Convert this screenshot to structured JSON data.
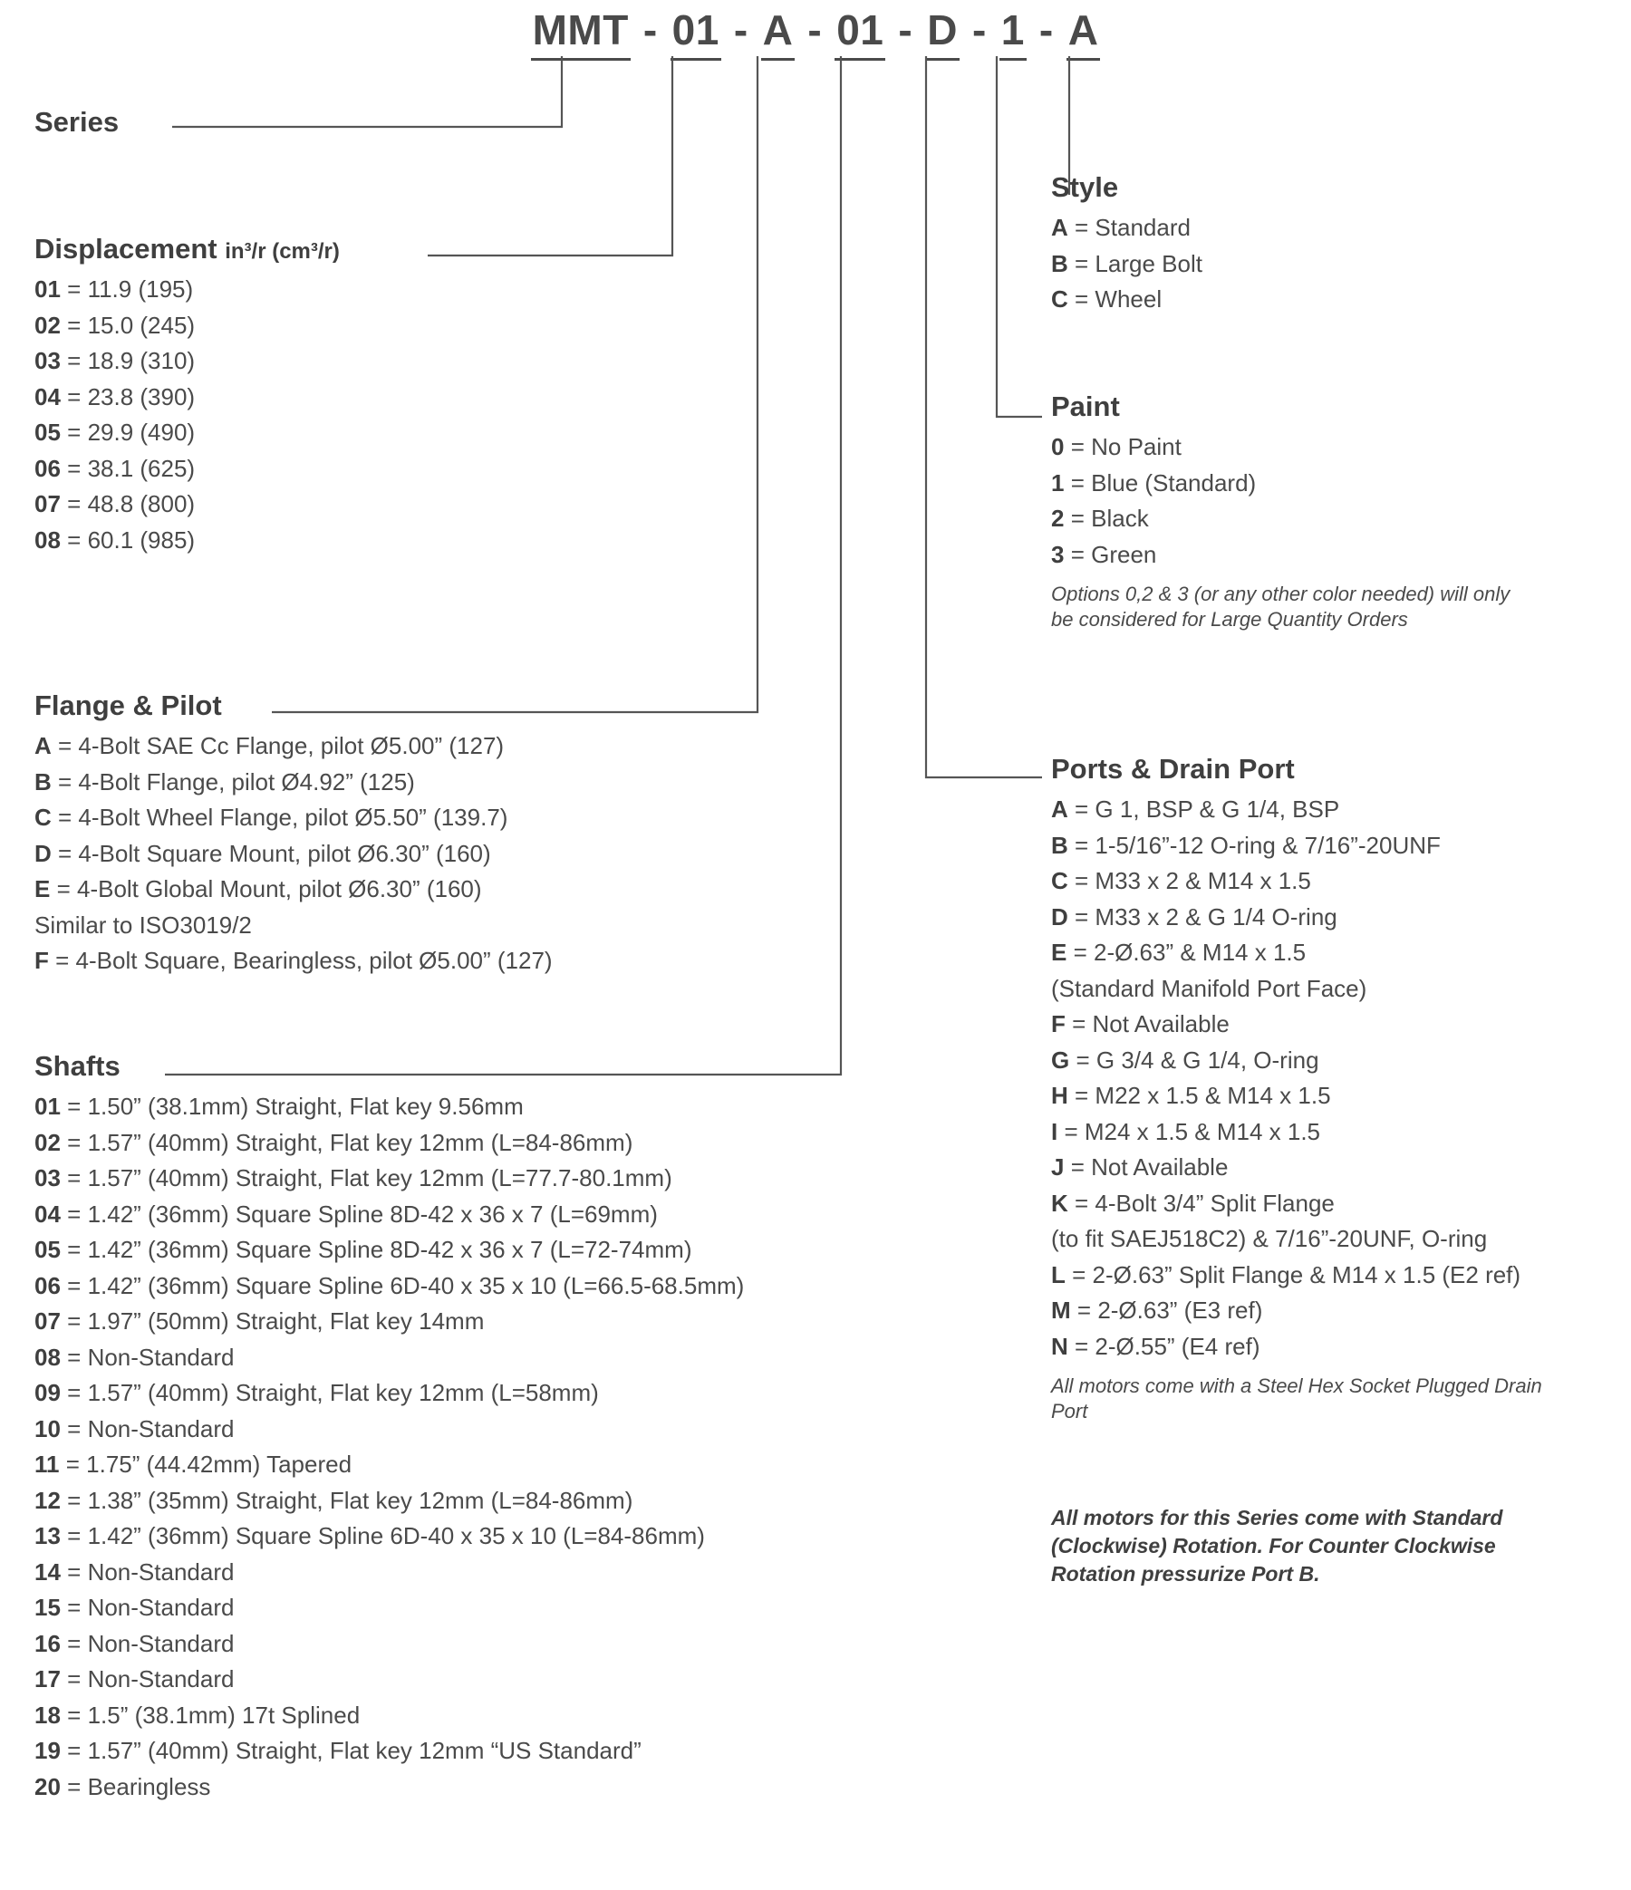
{
  "model_code": {
    "segments": [
      "MMT",
      "01",
      "A",
      "01",
      "D",
      "1",
      "A"
    ],
    "separator": "-"
  },
  "series": {
    "title": "Series"
  },
  "displacement": {
    "title": "Displacement",
    "units": "in³/r (cm³/r)",
    "options": [
      {
        "code": "01",
        "desc": "11.9 (195)"
      },
      {
        "code": "02",
        "desc": "15.0 (245)"
      },
      {
        "code": "03",
        "desc": "18.9 (310)"
      },
      {
        "code": "04",
        "desc": "23.8 (390)"
      },
      {
        "code": "05",
        "desc": "29.9 (490)"
      },
      {
        "code": "06",
        "desc": "38.1 (625)"
      },
      {
        "code": "07",
        "desc": "48.8 (800)"
      },
      {
        "code": "08",
        "desc": "60.1 (985)"
      }
    ]
  },
  "flange_pilot": {
    "title": "Flange & Pilot",
    "options": [
      {
        "code": "A",
        "desc": "4-Bolt SAE Cc Flange, pilot Ø5.00” (127)"
      },
      {
        "code": "B",
        "desc": "4-Bolt Flange, pilot Ø4.92” (125)"
      },
      {
        "code": "C",
        "desc": "4-Bolt Wheel Flange, pilot Ø5.50” (139.7)"
      },
      {
        "code": "D",
        "desc": "4-Bolt Square Mount, pilot Ø6.30” (160)"
      },
      {
        "code": "E",
        "desc": "4-Bolt Global Mount, pilot Ø6.30” (160)"
      },
      {
        "code": "",
        "desc": "Similar to ISO3019/2"
      },
      {
        "code": "F",
        "desc": "4-Bolt Square, Bearingless, pilot Ø5.00” (127)"
      }
    ]
  },
  "shafts": {
    "title": "Shafts",
    "options": [
      {
        "code": "01",
        "desc": "1.50” (38.1mm) Straight, Flat key 9.56mm"
      },
      {
        "code": "02",
        "desc": "1.57” (40mm) Straight, Flat key 12mm (L=84-86mm)"
      },
      {
        "code": "03",
        "desc": "1.57” (40mm) Straight, Flat key 12mm (L=77.7-80.1mm)"
      },
      {
        "code": "04",
        "desc": "1.42” (36mm) Square Spline 8D-42 x 36 x 7 (L=69mm)"
      },
      {
        "code": "05",
        "desc": "1.42” (36mm) Square Spline 8D-42 x 36 x 7 (L=72-74mm)"
      },
      {
        "code": "06",
        "desc": "1.42” (36mm) Square Spline 6D-40 x 35 x 10 (L=66.5-68.5mm)"
      },
      {
        "code": "07",
        "desc": "1.97” (50mm) Straight, Flat key 14mm"
      },
      {
        "code": "08",
        "desc": "Non-Standard"
      },
      {
        "code": "09",
        "desc": "1.57” (40mm) Straight, Flat key 12mm (L=58mm)"
      },
      {
        "code": "10",
        "desc": "Non-Standard"
      },
      {
        "code": "11",
        "desc": "1.75” (44.42mm) Tapered"
      },
      {
        "code": "12",
        "desc": "1.38” (35mm) Straight, Flat key 12mm (L=84-86mm)"
      },
      {
        "code": "13",
        "desc": "1.42” (36mm) Square Spline 6D-40 x 35 x 10 (L=84-86mm)"
      },
      {
        "code": "14",
        "desc": "Non-Standard"
      },
      {
        "code": "15",
        "desc": "Non-Standard"
      },
      {
        "code": "16",
        "desc": "Non-Standard"
      },
      {
        "code": "17",
        "desc": "Non-Standard"
      },
      {
        "code": "18",
        "desc": "1.5” (38.1mm) 17t Splined"
      },
      {
        "code": "19",
        "desc": "1.57” (40mm) Straight, Flat key 12mm “US Standard”"
      },
      {
        "code": "20",
        "desc": "Bearingless"
      }
    ]
  },
  "style": {
    "title": "Style",
    "options": [
      {
        "code": "A",
        "desc": "Standard"
      },
      {
        "code": "B",
        "desc": "Large Bolt"
      },
      {
        "code": "C",
        "desc": "Wheel"
      }
    ]
  },
  "paint": {
    "title": "Paint",
    "options": [
      {
        "code": "0",
        "desc": "No Paint"
      },
      {
        "code": "1",
        "desc": "Blue (Standard)"
      },
      {
        "code": "2",
        "desc": "Black"
      },
      {
        "code": "3",
        "desc": "Green"
      }
    ],
    "note": "Options 0,2 & 3 (or any other color needed) will only be considered for Large Quantity Orders"
  },
  "ports_drain_port": {
    "title": "Ports & Drain Port",
    "options": [
      {
        "code": "A",
        "desc": "G 1, BSP & G 1/4, BSP"
      },
      {
        "code": "B",
        "desc": "1-5/16”-12 O-ring & 7/16”-20UNF"
      },
      {
        "code": "C",
        "desc": "M33 x 2 & M14 x 1.5"
      },
      {
        "code": "D",
        "desc": "M33 x 2 & G 1/4 O-ring"
      },
      {
        "code": "E",
        "desc": "2-Ø.63” & M14 x 1.5"
      },
      {
        "code": "",
        "desc": "(Standard Manifold Port Face)"
      },
      {
        "code": "F",
        "desc": "Not Available"
      },
      {
        "code": "G",
        "desc": "G 3/4 & G 1/4, O-ring"
      },
      {
        "code": "H",
        "desc": "M22 x 1.5 & M14 x 1.5"
      },
      {
        "code": "I",
        "desc": "M24 x 1.5 & M14 x 1.5"
      },
      {
        "code": "J",
        "desc": "Not Available"
      },
      {
        "code": "K",
        "desc": "4-Bolt 3/4” Split Flange"
      },
      {
        "code": "",
        "desc": "(to fit SAEJ518C2) & 7/16”-20UNF, O-ring"
      },
      {
        "code": "L",
        "desc": "2-Ø.63” Split Flange & M14 x 1.5 (E2 ref)"
      },
      {
        "code": "M",
        "desc": "2-Ø.63” (E3 ref)"
      },
      {
        "code": "N",
        "desc": "2-Ø.55” (E4 ref)"
      }
    ],
    "note": "All motors come with a Steel Hex Socket Plugged Drain Port"
  },
  "rotation_note": "All motors for this Series come with Standard (Clockwise) Rotation. For Counter Clockwise Rotation pressurize Port B.",
  "colors": {
    "text": "#4a4a4a",
    "heading": "#3f3f3f",
    "line": "#555555",
    "background": "#ffffff"
  }
}
